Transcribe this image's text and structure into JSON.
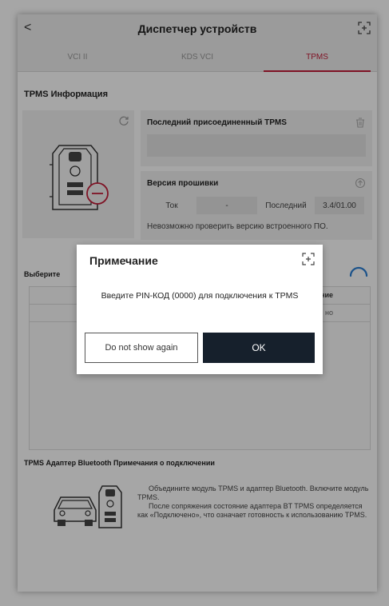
{
  "header": {
    "title": "Диспетчер устройств",
    "back_label": "<"
  },
  "tabs": [
    {
      "label": "VCI II",
      "active": false
    },
    {
      "label": "KDS VCI",
      "active": false
    },
    {
      "label": "TPMS",
      "active": true
    }
  ],
  "tpms_info": {
    "title": "TPMS Информация",
    "last_connected_label": "Последний присоединенный TPMS",
    "firmware_label": "Версия прошивки",
    "current_label": "Ток",
    "current_value": "-",
    "last_label": "Последний",
    "last_value": "3.4/01.00",
    "firmware_note": "Невозможно проверить версию встроенного ПО."
  },
  "select_section": {
    "label_partial": "Выберите",
    "column_tail": "ние",
    "row_tail": "но"
  },
  "bluetooth_notes": {
    "title": "TPMS Адаптер Bluetooth Примечания о подключении",
    "lines": [
      "Объедините модуль TPMS и адаптер Bluetooth. Включите модуль TPMS.",
      "После сопряжения состояние адаптера BT TPMS определяется как «Подключено», что означает готовность к использованию TPMS."
    ]
  },
  "modal": {
    "title": "Примечание",
    "message": "Введите PIN-КОД (0000) для подключения к TPMS",
    "secondary_button": "Do not show again",
    "primary_button": "OK"
  },
  "colors": {
    "accent": "#c41e3a",
    "primary_button": "#16202c",
    "spinner": "#2a7fd4"
  }
}
